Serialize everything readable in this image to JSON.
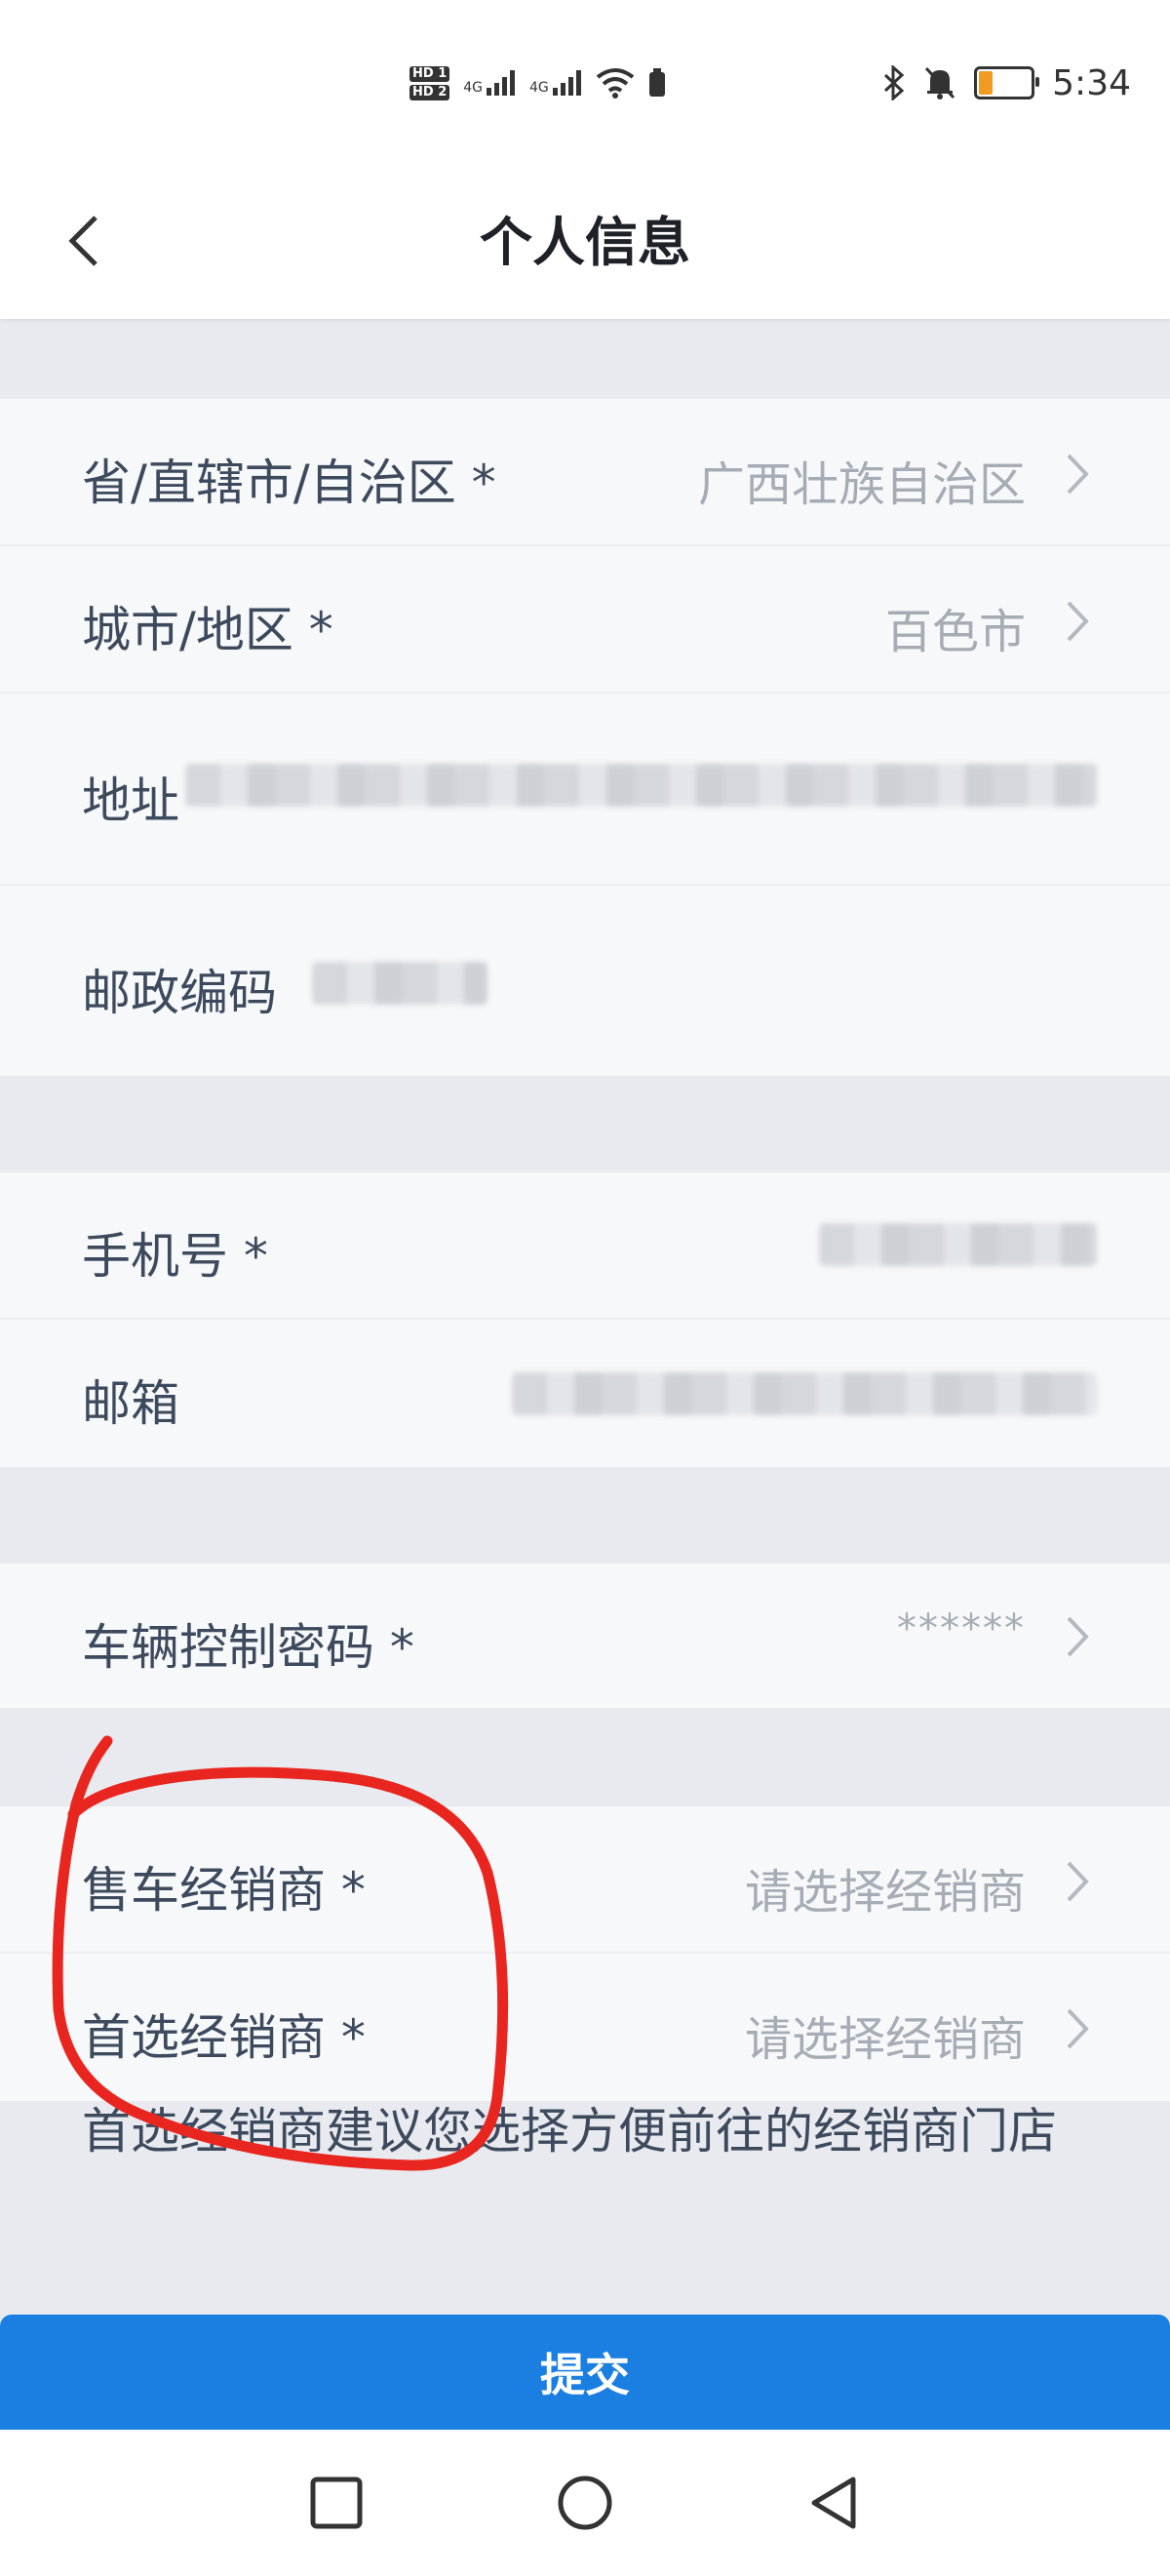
{
  "status_bar": {
    "time": "5:34",
    "sim1": "HD 1",
    "sim2": "HD 2",
    "net1": "4G",
    "net2": "4G",
    "icons": [
      "hd-sim-icon",
      "signal-icon",
      "signal-icon",
      "wifi-icon",
      "bluetooth-icon",
      "mute-bell-icon",
      "battery-icon"
    ]
  },
  "header": {
    "title": "个人信息",
    "back_icon": "chevron-left-icon"
  },
  "form": {
    "province": {
      "label": "省/直辖市/自治区 *",
      "value": "广西壮族自治区"
    },
    "city": {
      "label": "城市/地区 *",
      "value": "百色市"
    },
    "address": {
      "label": "地址",
      "value": ""
    },
    "postal": {
      "label": "邮政编码",
      "value": ""
    },
    "phone": {
      "label": "手机号 *",
      "value": ""
    },
    "email": {
      "label": "邮箱",
      "value": ""
    },
    "vehicle_password": {
      "label": "车辆控制密码 *",
      "value": "******"
    },
    "sales_dealer": {
      "label": "售车经销商 *",
      "value": "请选择经销商"
    },
    "preferred_dealer": {
      "label": "首选经销商 *",
      "value": "请选择经销商"
    }
  },
  "note": "首选经销商建议您选择方便前往的经销商门店",
  "submit_label": "提交",
  "nav": [
    "recents-square-icon",
    "home-circle-icon",
    "back-triangle-icon"
  ],
  "colors": {
    "primary": "#1a7fe0",
    "annotation": "#e8261f",
    "battery": "#f29b22"
  }
}
